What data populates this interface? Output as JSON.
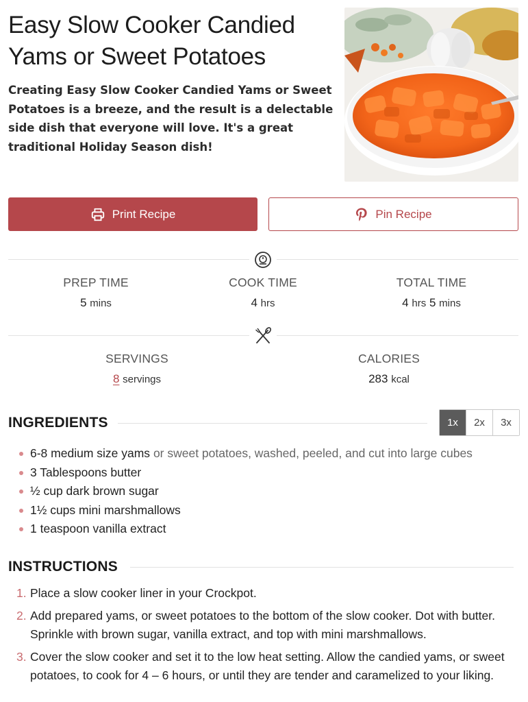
{
  "recipe": {
    "title": "Easy Slow Cooker Candied Yams or Sweet Potatoes",
    "summary": "Creating Easy Slow Cooker Candied Yams or Sweet Potatoes is a breeze, and the result is a delectable side dish that everyone will love. It's a great traditional Holiday Season dish!"
  },
  "actions": {
    "print_label": "Print Recipe",
    "pin_label": "Pin Recipe",
    "print_icon": "printer-icon",
    "pin_icon": "pinterest-icon"
  },
  "times": {
    "icon": "timer-icon",
    "prep": {
      "label": "PREP TIME",
      "value": "5",
      "unit": "mins"
    },
    "cook": {
      "label": "COOK TIME",
      "value": "4",
      "unit": "hrs"
    },
    "total": {
      "label": "TOTAL TIME",
      "value_hours": "4",
      "unit_hours": "hrs",
      "value_mins": "5",
      "unit_mins": "mins"
    }
  },
  "nutrition": {
    "icon": "utensils-icon",
    "servings": {
      "label": "SERVINGS",
      "value": "8",
      "unit": "servings"
    },
    "calories": {
      "label": "CALORIES",
      "value": "283",
      "unit": "kcal"
    }
  },
  "ingredients": {
    "heading": "INGREDIENTS",
    "scale_options": [
      "1x",
      "2x",
      "3x"
    ],
    "scale_selected": "1x",
    "items": [
      {
        "text": "6-8 medium size yams",
        "note": "or sweet potatoes, washed, peeled, and cut into large cubes"
      },
      {
        "text": "3 Tablespoons butter",
        "note": ""
      },
      {
        "text": "½ cup dark brown sugar",
        "note": ""
      },
      {
        "text": "1½ cups mini marshmallows",
        "note": ""
      },
      {
        "text": "1 teaspoon vanilla extract",
        "note": ""
      }
    ]
  },
  "instructions": {
    "heading": "INSTRUCTIONS",
    "steps": [
      {
        "number": "1.",
        "text": "Place a slow cooker liner in your Crockpot."
      },
      {
        "number": "2.",
        "text": "Add prepared yams, or sweet potatoes to the bottom of the slow cooker. Dot with butter. Sprinkle with brown sugar, vanilla extract, and top with mini marshmallows."
      },
      {
        "number": "3.",
        "text": "Cover the slow cooker and set it to the low heat setting. Allow the candied yams, or sweet potatoes, to cook for 4 – 6 hours, or until they are tender and caramelized to your liking."
      }
    ]
  },
  "colors": {
    "accent": "#b5474b",
    "bullet": "#d98a8d",
    "scale_active": "#5b5b5b",
    "divider": "#e2e2e2"
  }
}
